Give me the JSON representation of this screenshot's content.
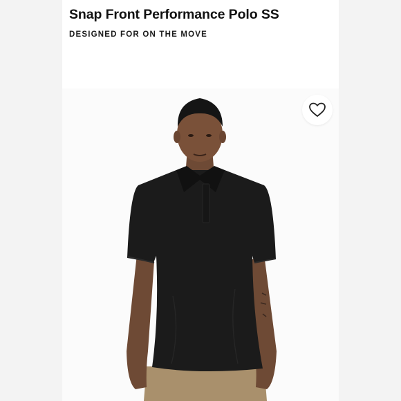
{
  "product": {
    "title": "Snap Front Performance Polo SS",
    "tagline": "DESIGNED FOR ON THE MOVE"
  },
  "wishlist": {
    "icon": "heart-outline-icon"
  },
  "image": {
    "subject": "model-wearing-black-polo",
    "shirt_color": "#1b1b1b",
    "pants_color": "#a9906c"
  }
}
